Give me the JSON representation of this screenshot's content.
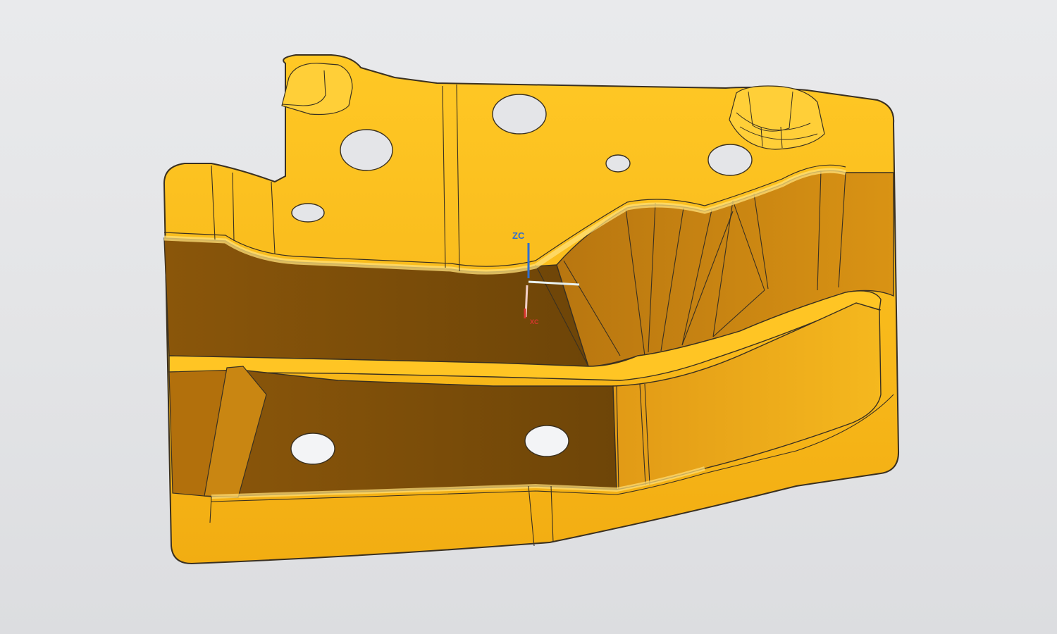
{
  "viewport": {
    "background_color": "#e5e6e8",
    "part_color": "#f5b418",
    "part_shadow_color": "#7a4e0a",
    "edge_color": "#3a3020"
  },
  "csys": {
    "z_label": "ZC",
    "x_label": "",
    "y_label": "XC",
    "z_color": "#2f6fd1",
    "x_color": "#e9f2f0",
    "y_color": "#d9362f"
  }
}
